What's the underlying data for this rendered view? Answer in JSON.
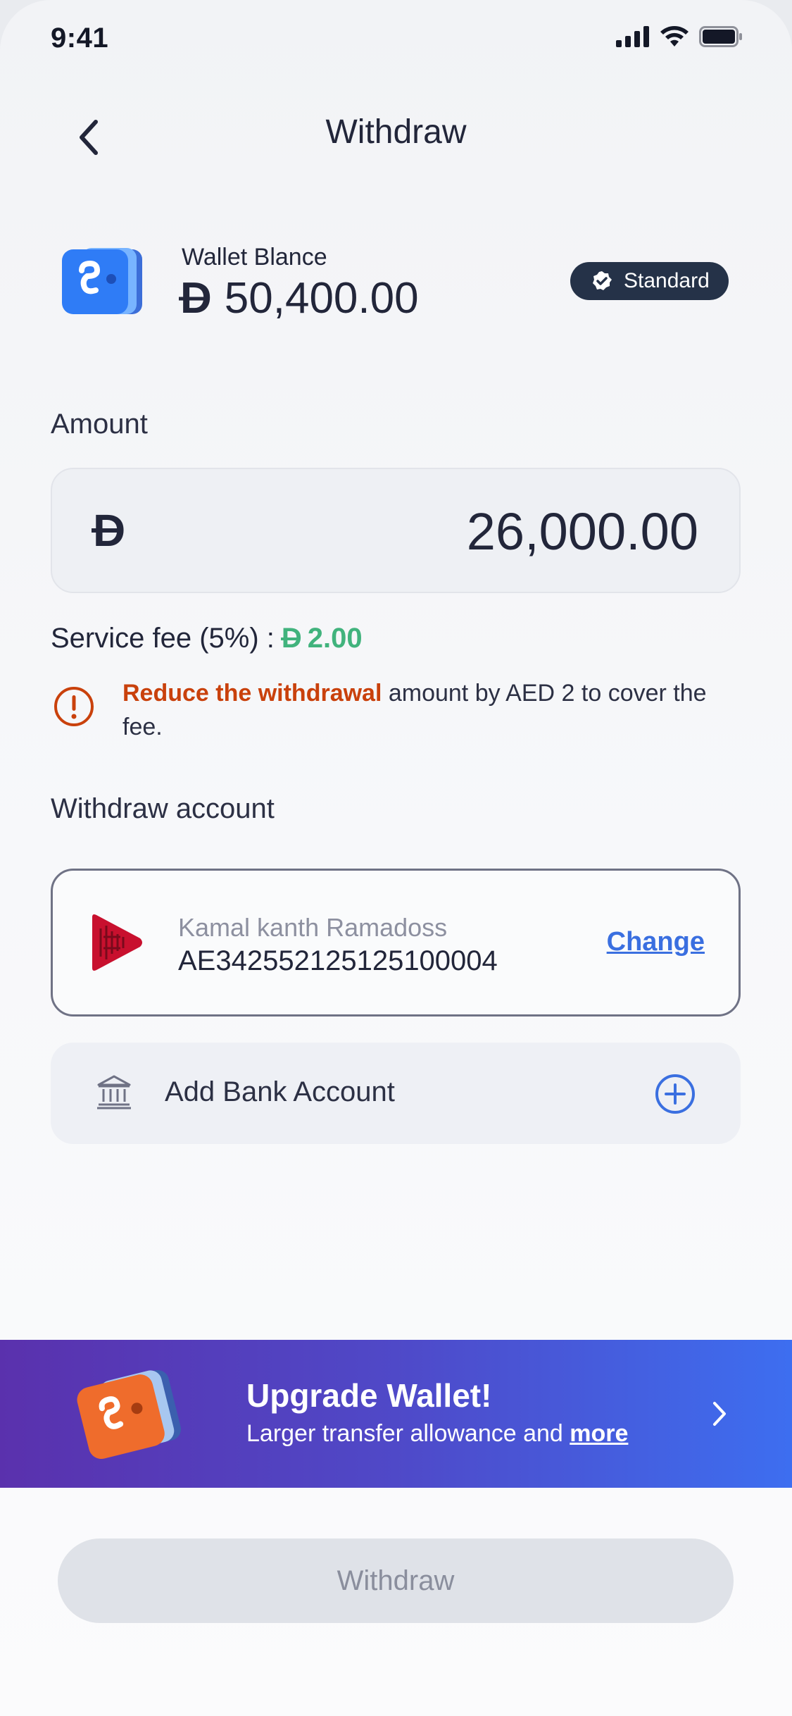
{
  "status_bar": {
    "time": "9:41"
  },
  "header": {
    "title": "Withdraw",
    "back_icon": "chevron-left-icon"
  },
  "wallet": {
    "label": "Wallet Blance",
    "currency_symbol": "D",
    "balance": "50,400.00",
    "tier_badge": "Standard",
    "icon": "wallet-icon",
    "accent_color": "#2f7cf6"
  },
  "amount": {
    "label": "Amount",
    "currency_symbol": "D",
    "value": "26,000.00"
  },
  "service_fee": {
    "label": "Service fee (5%) :",
    "currency_symbol": "D",
    "value": "2.00",
    "color": "#41b37d"
  },
  "warning": {
    "strong": "Reduce the withdrawal",
    "rest": " amount by AED 2 to cover the fee.",
    "color": "#c9410c",
    "icon": "alert-circle-icon"
  },
  "withdraw_account": {
    "label": "Withdraw account",
    "holder_name": "Kamal kanth Ramadoss",
    "iban": "AE342552125125100004",
    "change_label": "Change",
    "bank_logo": "bank-logo-icon"
  },
  "add_bank": {
    "label": "Add Bank Account",
    "icon": "bank-building-icon",
    "action_icon": "plus-circle-icon"
  },
  "upgrade_banner": {
    "title": "Upgrade Wallet!",
    "subtitle": "Larger transfer allowance and ",
    "more_link": "more",
    "icon": "wallet-upgrade-icon",
    "chevron_icon": "chevron-right-icon"
  },
  "footer": {
    "withdraw_button": "Withdraw"
  }
}
